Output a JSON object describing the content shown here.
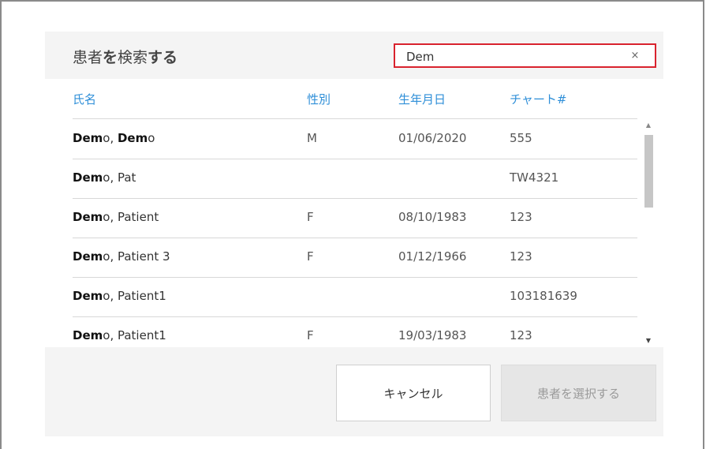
{
  "dialog": {
    "title_prefix": "患者",
    "title_bold": "を",
    "title_suffix": "検索",
    "title_end": "する"
  },
  "search": {
    "value": "Dem",
    "clear_glyph": "×"
  },
  "table": {
    "headers": {
      "name": "氏名",
      "sex": "性別",
      "dob": "生年月日",
      "chart": "チャート#"
    },
    "rows": [
      {
        "name_match_1": "Dem",
        "name_rest_1": "o, ",
        "name_match_2": "Dem",
        "name_rest_2": "o",
        "sex": "M",
        "dob": "01/06/2020",
        "chart": "555"
      },
      {
        "name_match_1": "Dem",
        "name_rest_1": "o, Pat",
        "name_match_2": "",
        "name_rest_2": "",
        "sex": "",
        "dob": "",
        "chart": "TW4321"
      },
      {
        "name_match_1": "Dem",
        "name_rest_1": "o, Patient",
        "name_match_2": "",
        "name_rest_2": "",
        "sex": "F",
        "dob": "08/10/1983",
        "chart": "123"
      },
      {
        "name_match_1": "Dem",
        "name_rest_1": "o, Patient 3",
        "name_match_2": "",
        "name_rest_2": "",
        "sex": "F",
        "dob": "01/12/1966",
        "chart": "123"
      },
      {
        "name_match_1": "Dem",
        "name_rest_1": "o, Patient1",
        "name_match_2": "",
        "name_rest_2": "",
        "sex": "",
        "dob": "",
        "chart": "103181639"
      },
      {
        "name_match_1": "Dem",
        "name_rest_1": "o, Patient1",
        "name_match_2": "",
        "name_rest_2": "",
        "sex": "F",
        "dob": "19/03/1983",
        "chart": "123"
      }
    ]
  },
  "scrollbar": {
    "up_glyph": "▲",
    "down_glyph": "▼"
  },
  "footer": {
    "cancel_label": "キャンセル",
    "select_label": "患者を選択する"
  },
  "colors": {
    "accent": "#2f8fd8",
    "search_border": "#d9232e",
    "dialog_bg": "#f4f4f4"
  }
}
